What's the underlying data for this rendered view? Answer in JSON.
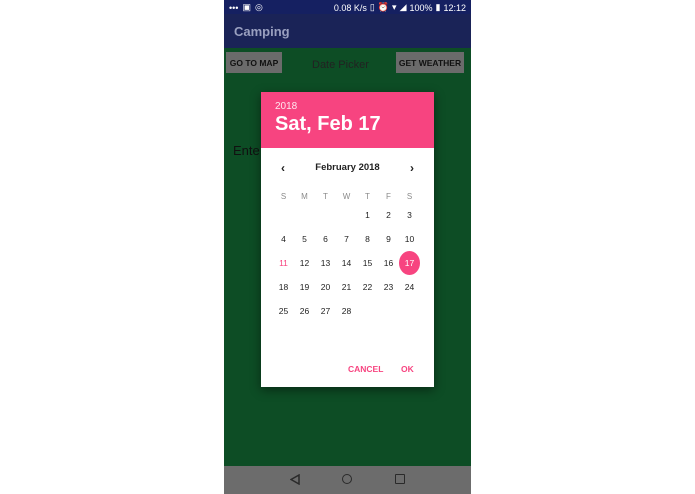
{
  "status_bar": {
    "speed": "0.08 K/s",
    "battery": "100%",
    "time": "12:12"
  },
  "app_bar": {
    "title": "Camping"
  },
  "main": {
    "go_to_map_label": "GO TO MAP",
    "date_picker_label": "Date Picker",
    "get_weather_label": "GET WEATHER",
    "enter_text": "Ente"
  },
  "dialog": {
    "year": "2018",
    "selected_date": "Sat, Feb 17",
    "month_label": "February 2018",
    "prev_icon": "‹",
    "next_icon": "›",
    "weekdays": [
      "S",
      "M",
      "T",
      "W",
      "T",
      "F",
      "S"
    ],
    "weeks": [
      [
        "",
        "",
        "",
        "",
        "1",
        "2",
        "3"
      ],
      [
        "4",
        "5",
        "6",
        "7",
        "8",
        "9",
        "10"
      ],
      [
        "11",
        "12",
        "13",
        "14",
        "15",
        "16",
        "17"
      ],
      [
        "18",
        "19",
        "20",
        "21",
        "22",
        "23",
        "24"
      ],
      [
        "25",
        "26",
        "27",
        "28",
        "",
        "",
        ""
      ]
    ],
    "today": "11",
    "selected_day": "17",
    "cancel_label": "CANCEL",
    "ok_label": "OK",
    "accent_color": "#f74480"
  }
}
